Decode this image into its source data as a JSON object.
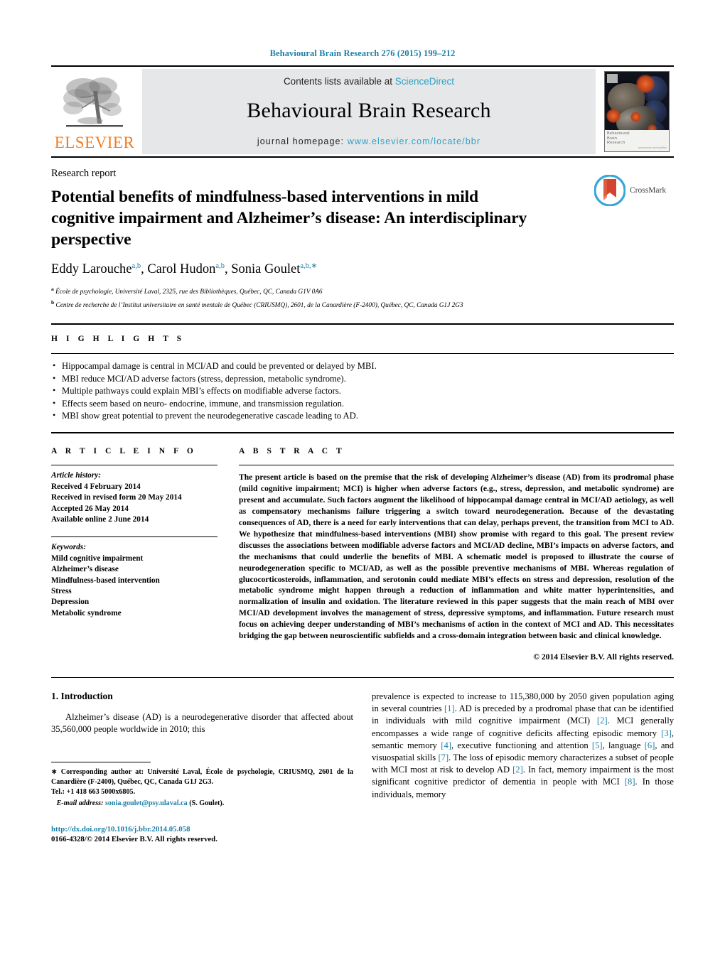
{
  "running_head": "Behavioural Brain Research 276 (2015) 199–212",
  "masthead": {
    "publisher_name": "ELSEVIER",
    "contents_prefix": "Contents lists available at ",
    "contents_link": "ScienceDirect",
    "journal_title": "Behavioural Brain Research",
    "homepage_label": "journal homepage: ",
    "homepage_url": "www.elsevier.com/locate/bbr",
    "cover_title_line1": "Behavioural",
    "cover_title_line2": "Brain",
    "cover_title_line3": "Research",
    "cover_small_text": "www.elsevier.com/locate/bbr"
  },
  "article": {
    "kicker": "Research report",
    "title": "Potential benefits of mindfulness-based interventions in mild cognitive impairment and Alzheimer’s disease: An interdisciplinary perspective",
    "crossmark_label": "CrossMark",
    "authors": [
      {
        "name": "Eddy Larouche",
        "sup": "a,b",
        "sep": ", "
      },
      {
        "name": "Carol Hudon",
        "sup": "a,b",
        "sep": ", "
      },
      {
        "name": "Sonia Goulet",
        "sup": "a,b,∗",
        "sep": ""
      }
    ],
    "affiliations": [
      {
        "marker": "a",
        "text": "École de psychologie, Université Laval, 2325, rue des Bibliothèques, Québec, QC, Canada G1V 0A6"
      },
      {
        "marker": "b",
        "text": "Centre de recherche de l’Institut universitaire en santé mentale de Québec (CRIUSMQ), 2601, de la Canardière (F-2400), Québec, QC, Canada G1J 2G3"
      }
    ]
  },
  "highlights": {
    "heading": "H I G H L I G H T S",
    "items": [
      "Hippocampal damage is central in MCI/AD and could be prevented or delayed by MBI.",
      "MBI reduce MCI/AD adverse factors (stress, depression, metabolic syndrome).",
      "Multiple pathways could explain MBI’s effects on modifiable adverse factors.",
      "Effects seem based on neuro- endocrine, immune, and transmission regulation.",
      "MBI show great potential to prevent the neurodegenerative cascade leading to AD."
    ]
  },
  "article_info": {
    "heading": "A R T I C L E   I N F O",
    "history_label": "Article history:",
    "history": [
      "Received 4 February 2014",
      "Received in revised form 20 May 2014",
      "Accepted 26 May 2014",
      "Available online 2 June 2014"
    ],
    "keywords_label": "Keywords:",
    "keywords": [
      "Mild cognitive impairment",
      "Alzheimer’s disease",
      "Mindfulness-based intervention",
      "Stress",
      "Depression",
      "Metabolic syndrome"
    ]
  },
  "abstract": {
    "heading": "A B S T R A C T",
    "text": "The present article is based on the premise that the risk of developing Alzheimer’s disease (AD) from its prodromal phase (mild cognitive impairment; MCI) is higher when adverse factors (e.g., stress, depression, and metabolic syndrome) are present and accumulate. Such factors augment the likelihood of hippocampal damage central in MCI/AD aetiology, as well as compensatory mechanisms failure triggering a switch toward neurodegeneration. Because of the devastating consequences of AD, there is a need for early interventions that can delay, perhaps prevent, the transition from MCI to AD. We hypothesize that mindfulness-based interventions (MBI) show promise with regard to this goal. The present review discusses the associations between modifiable adverse factors and MCI/AD decline, MBI’s impacts on adverse factors, and the mechanisms that could underlie the benefits of MBI. A schematic model is proposed to illustrate the course of neurodegeneration specific to MCI/AD, as well as the possible preventive mechanisms of MBI. Whereas regulation of glucocorticosteroids, inflammation, and serotonin could mediate MBI’s effects on stress and depression, resolution of the metabolic syndrome might happen through a reduction of inflammation and white matter hyperintensities, and normalization of insulin and oxidation. The literature reviewed in this paper suggests that the main reach of MBI over MCI/AD development involves the management of stress, depressive symptoms, and inflammation. Future research must focus on achieving deeper understanding of MBI’s mechanisms of action in the context of MCI and AD. This necessitates bridging the gap between neuroscientific subfields and a cross-domain integration between basic and clinical knowledge.",
    "copyright": "© 2014 Elsevier B.V. All rights reserved."
  },
  "body": {
    "section_number_title": "1.  Introduction",
    "left_paragraph": "Alzheimer’s disease (AD) is a neurodegenerative disorder that affected about 35,560,000 people worldwide in 2010; this",
    "right_parts": [
      {
        "t": "prevalence is expected to increase to 115,380,000 by 2050 given population aging in several countries ",
        "k": "text"
      },
      {
        "t": "[1]",
        "k": "ref"
      },
      {
        "t": ". AD is preceded by a prodromal phase that can be identified in individuals with mild cognitive impairment (MCI) ",
        "k": "text"
      },
      {
        "t": "[2]",
        "k": "ref"
      },
      {
        "t": ". MCI generally encompasses a wide range of cognitive deficits affecting episodic memory ",
        "k": "text"
      },
      {
        "t": "[3]",
        "k": "ref"
      },
      {
        "t": ", semantic memory ",
        "k": "text"
      },
      {
        "t": "[4]",
        "k": "ref"
      },
      {
        "t": ", executive functioning and attention ",
        "k": "text"
      },
      {
        "t": "[5]",
        "k": "ref"
      },
      {
        "t": ", language ",
        "k": "text"
      },
      {
        "t": "[6]",
        "k": "ref"
      },
      {
        "t": ", and visuospatial skills ",
        "k": "text"
      },
      {
        "t": "[7]",
        "k": "ref"
      },
      {
        "t": ". The loss of episodic memory characterizes a subset of people with MCI most at risk to develop AD ",
        "k": "text"
      },
      {
        "t": "[2]",
        "k": "ref"
      },
      {
        "t": ". In fact, memory impairment is the most significant cognitive predictor of dementia in people with MCI ",
        "k": "text"
      },
      {
        "t": "[8]",
        "k": "ref"
      },
      {
        "t": ". In those individuals, memory",
        "k": "text"
      }
    ]
  },
  "footnotes": {
    "corresponding": "∗ Corresponding author at: Université Laval, École de psychologie, CRIUSMQ, 2601 de la Canardière (F-2400), Québec, QC, Canada G1J 2G3.",
    "tel": "Tel.: +1 418 663 5000x6805.",
    "email_label": "E-mail address:",
    "email_address": "sonia.goulet@psy.ulaval.ca",
    "email_suffix": "(S. Goulet).",
    "doi": "http://dx.doi.org/10.1016/j.bbr.2014.05.058",
    "issn_line": "0166-4328/© 2014 Elsevier B.V. All rights reserved."
  },
  "colors": {
    "link": "#1a7fa8",
    "sciencedirect": "#2aa3c7",
    "elsevier_orange": "#F47C20",
    "masthead_gray": "#e6e7e8"
  }
}
